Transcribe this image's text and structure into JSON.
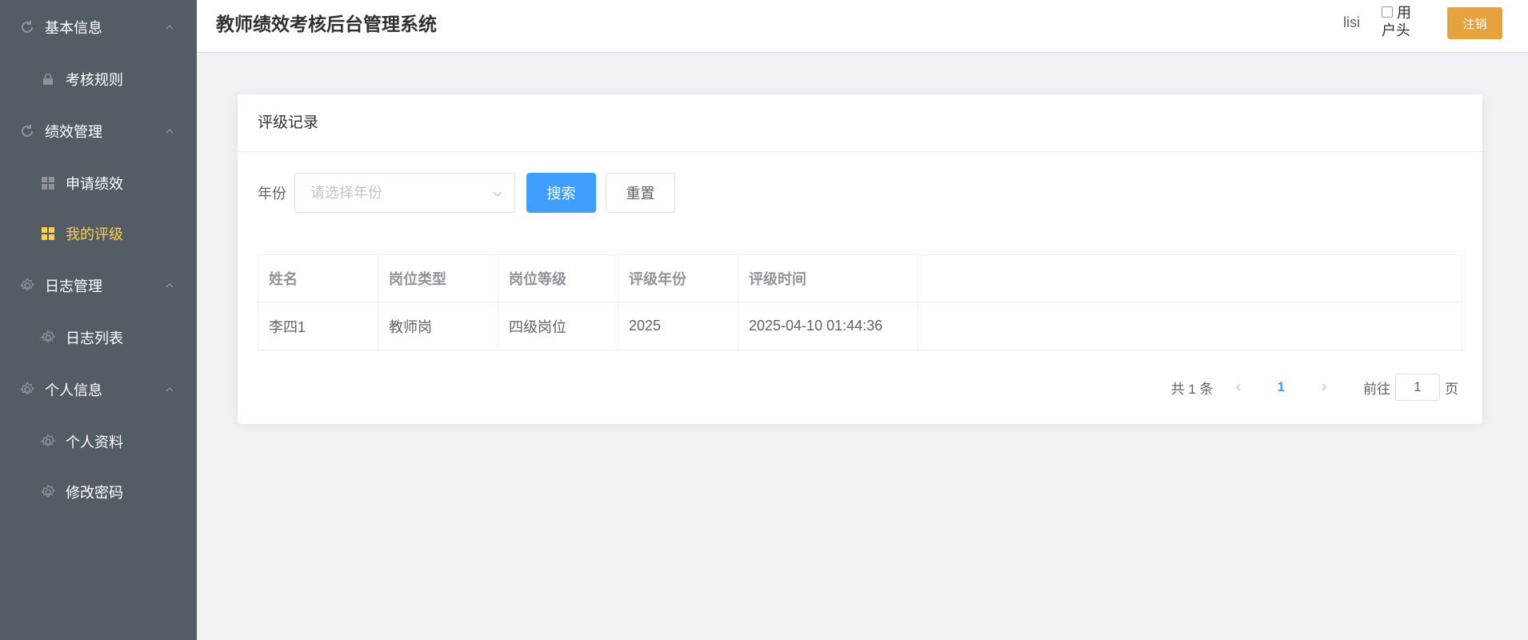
{
  "sidebar": {
    "groups": [
      {
        "title": "基本信息",
        "icon": "refresh-icon",
        "items": [
          {
            "label": "考核规则",
            "icon": "lock-icon"
          }
        ]
      },
      {
        "title": "绩效管理",
        "icon": "refresh-icon",
        "items": [
          {
            "label": "申请绩效",
            "icon": "grid-icon"
          },
          {
            "label": "我的评级",
            "icon": "grid-icon",
            "active": true
          }
        ]
      },
      {
        "title": "日志管理",
        "icon": "gear-icon",
        "items": [
          {
            "label": "日志列表",
            "icon": "gear-icon"
          }
        ]
      },
      {
        "title": "个人信息",
        "icon": "gear-icon",
        "items": [
          {
            "label": "个人资料",
            "icon": "gear-icon"
          },
          {
            "label": "修改密码",
            "icon": "gear-icon"
          }
        ]
      }
    ]
  },
  "header": {
    "title": "教师绩效考核后台管理系统",
    "username": "lisi",
    "avatar_alt_line1": "用",
    "avatar_alt_line2": "户头",
    "logout_label": "注销"
  },
  "card": {
    "title": "评级记录",
    "filter": {
      "year_label": "年份",
      "year_placeholder": "请选择年份",
      "search_label": "搜索",
      "reset_label": "重置"
    },
    "table": {
      "columns": [
        "姓名",
        "岗位类型",
        "岗位等级",
        "评级年份",
        "评级时间"
      ],
      "rows": [
        [
          "李四1",
          "教师岗",
          "四级岗位",
          "2025",
          "2025-04-10 01:44:36"
        ]
      ]
    },
    "pagination": {
      "total_text": "共 1 条",
      "current_page": "1",
      "goto_label": "前往",
      "goto_value": "1",
      "page_suffix": "页"
    }
  },
  "colors": {
    "sidebar_bg": "#545c64",
    "active_menu": "#ffd04b",
    "primary": "#409eff",
    "warning": "#e6a23c"
  }
}
